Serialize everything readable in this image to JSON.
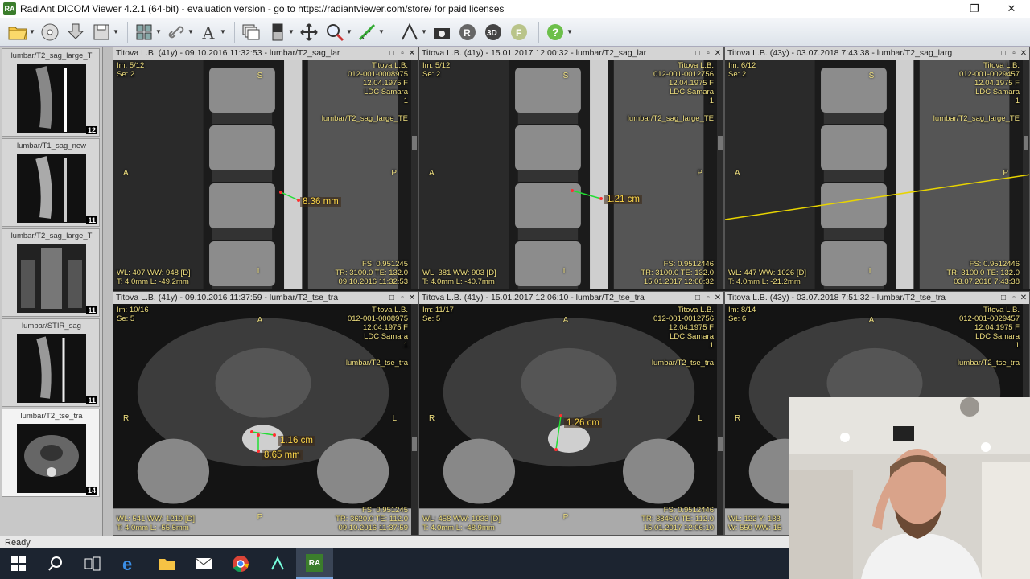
{
  "window": {
    "title": "RadiAnt DICOM Viewer 4.2.1 (64-bit) - evaluation version - go to https://radiantviewer.com/store/ for paid licenses",
    "app_icon_text": "RA",
    "minimize": "—",
    "restore": "❐",
    "close": "✕"
  },
  "toolbar": {
    "icons": [
      "open-folder-icon",
      "cd-icon",
      "download-icon",
      "save-icon",
      "layout-grid-icon",
      "link-icon",
      "text-annotation-icon",
      "series-stack-icon",
      "window-level-icon",
      "pan-move-icon",
      "zoom-icon",
      "measure-icon",
      "angle-icon",
      "mpr-icon",
      "volume-3d-icon",
      "fusion-icon",
      "help-icon"
    ]
  },
  "sidebar": {
    "thumbnails": [
      {
        "label": "lumbar/T2_sag_large_T",
        "count": "12",
        "active": false
      },
      {
        "label": "lumbar/T1_sag_new",
        "count": "11",
        "active": false
      },
      {
        "label": "lumbar/T2_sag_large_T",
        "count": "11",
        "active": false
      },
      {
        "label": "lumbar/STIR_sag",
        "count": "11",
        "active": false
      },
      {
        "label": "lumbar/T2_tse_tra",
        "count": "14",
        "active": true
      }
    ]
  },
  "viewports": [
    {
      "header": "Titova L.B. (41y) - 09.10.2016 11:32:53 - lumbar/T2_sag_lar",
      "tl": [
        "Im: 5/12",
        "Se: 2"
      ],
      "tr": [
        "Titova L.B.",
        "012-001-0008975",
        "12.04.1975 F",
        "LDC Samara",
        "1",
        "",
        "lumbar/T2_sag_large_TE"
      ],
      "bl": [
        "WL: 407 WW: 948 [D]",
        "T: 4.0mm L: -49.2mm"
      ],
      "br": [
        "FS: 0.951245",
        "TR: 3100.0 TE: 132.0",
        "09.10.2016 11:32:53"
      ],
      "orient": {
        "top": "S",
        "left": "A",
        "right": "P",
        "bottom": "I"
      },
      "measurements": [
        "8.36 mm"
      ]
    },
    {
      "header": "Titova L.B. (41y) - 15.01.2017 12:00:32 - lumbar/T2_sag_lar",
      "tl": [
        "Im: 5/12",
        "Se: 2"
      ],
      "tr": [
        "Titova L.B.",
        "012-001-0012756",
        "12.04.1975 F",
        "LDC Samara",
        "1",
        "",
        "lumbar/T2_sag_large_TE"
      ],
      "bl": [
        "WL: 381 WW: 903 [D]",
        "T: 4.0mm L: -40.7mm"
      ],
      "br": [
        "FS: 0.9512446",
        "TR: 3100.0 TE: 132.0",
        "15.01.2017 12:00:32"
      ],
      "orient": {
        "top": "S",
        "left": "A",
        "right": "P",
        "bottom": "I"
      },
      "measurements": [
        "1.21 cm"
      ]
    },
    {
      "header": "Titova L.B. (43y) - 03.07.2018 7:43:38 - lumbar/T2_sag_larg",
      "tl": [
        "Im: 6/12",
        "Se: 2"
      ],
      "tr": [
        "Titova L.B.",
        "012-001-0029457",
        "12.04.1975 F",
        "LDC Samara",
        "1",
        "",
        "lumbar/T2_sag_large_TE"
      ],
      "bl": [
        "WL: 447 WW: 1026 [D]",
        "T: 4.0mm L: -21.2mm"
      ],
      "br": [
        "FS: 0.9512446",
        "TR: 3100.0 TE: 132.0",
        "03.07.2018 7:43:38"
      ],
      "orient": {
        "top": "S",
        "left": "A",
        "right": "P",
        "bottom": "I"
      },
      "measurements": []
    },
    {
      "header": "Titova L.B. (41y) - 09.10.2016 11:37:59 - lumbar/T2_tse_tra",
      "tl": [
        "Im: 10/16",
        "Se: 5"
      ],
      "tr": [
        "Titova L.B.",
        "012-001-0008975",
        "12.04.1975 F",
        "LDC Samara",
        "1",
        "",
        "lumbar/T2_tse_tra"
      ],
      "bl": [
        "WL: 541 WW: 1219 [D]",
        "T: 4.0mm L: -55.5mm"
      ],
      "br": [
        "FS: 0.951245",
        "TR: 3620.0 TE: 112.0",
        "09.10.2016 11:37:59"
      ],
      "orient": {
        "top": "A",
        "left": "R",
        "right": "L",
        "bottom": "P"
      },
      "measurements": [
        "1.16 cm",
        "8.65 mm"
      ]
    },
    {
      "header": "Titova L.B. (41y) - 15.01.2017 12:06:10 - lumbar/T2_tse_tra",
      "tl": [
        "Im: 11/17",
        "Se: 5"
      ],
      "tr": [
        "Titova L.B.",
        "012-001-0012756",
        "12.04.1975 F",
        "LDC Samara",
        "1",
        "",
        "lumbar/T2_tse_tra"
      ],
      "bl": [
        "WL: 458 WW: 1033 [D]",
        "T: 4.0mm L: -48.9mm"
      ],
      "br": [
        "FS: 0.9512446",
        "TR: 3846.0 TE: 112.0",
        "15.01.2017 12:06:10"
      ],
      "orient": {
        "top": "A",
        "left": "R",
        "right": "L",
        "bottom": "P"
      },
      "measurements": [
        "1.26 cm"
      ]
    },
    {
      "header": "Titova L.B. (43y) - 03.07.2018 7:51:32 - lumbar/T2_tse_tra",
      "tl": [
        "Im: 8/14",
        "Se: 6"
      ],
      "tr": [
        "Titova L.B.",
        "012-001-0029457",
        "12.04.1975 F",
        "LDC Samara",
        "1",
        "",
        "lumbar/T2_tse_tra"
      ],
      "bl": [
        "WL: 122 Y: 133",
        "W: 550 WW: 15"
      ],
      "br": [
        "",
        "",
        ""
      ],
      "orient": {
        "top": "A",
        "left": "R",
        "right": "",
        "bottom": ""
      },
      "measurements": []
    }
  ],
  "status": {
    "text": "Ready"
  },
  "taskbar": {
    "items": [
      "windows-start-icon",
      "search-icon",
      "task-view-icon",
      "edge-browser-icon",
      "file-explorer-icon",
      "mail-icon",
      "chrome-icon",
      "app-icon",
      "radiant-icon"
    ],
    "radiant_label": "RA"
  }
}
